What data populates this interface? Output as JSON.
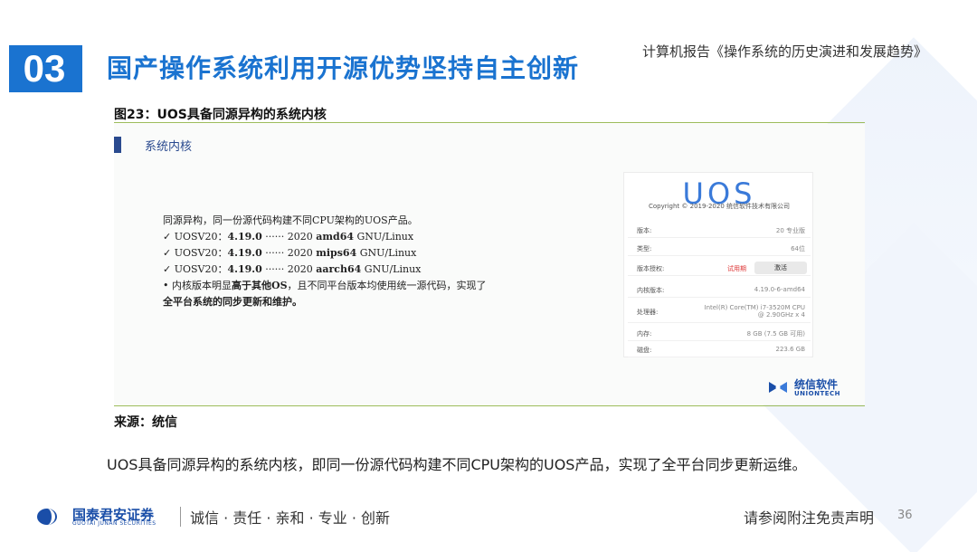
{
  "header": {
    "section_number": "03",
    "section_title": "国产操作系统利用开源优势坚持自主创新",
    "report_title": "计算机报告《操作系统的历史演进和发展趋势》"
  },
  "figure": {
    "title": "图23：UOS具备同源异构的系统内核",
    "source": "来源：统信",
    "screenshot": {
      "heading": "系统内核",
      "lead": "同源异构，同一份源代码构建不同CPU架构的UOS产品。",
      "items": [
        {
          "prefix": "✓ UOSV20：",
          "version": "4.19.0",
          "mid": " ······ 2020 ",
          "arch": "amd64",
          "suffix": " GNU/Linux"
        },
        {
          "prefix": "✓ UOSV20：",
          "version": "4.19.0",
          "mid": " ······ 2020 ",
          "arch": "mips64",
          "suffix": " GNU/Linux"
        },
        {
          "prefix": "✓ UOSV20：",
          "version": "4.19.0",
          "mid": " ······ 2020 ",
          "arch": "aarch64",
          "suffix": " GNU/Linux"
        }
      ],
      "note_a": "• 内核版本明显",
      "note_b": "高于其他OS",
      "note_c": "，且不同平台版本均使用统一源代码，实现了",
      "note_d": "全平台系统的同步更新和维护。",
      "sysinfo": {
        "logo": "UOS",
        "copyright": "Copyright © 2019-2020 统信软件技术有限公司",
        "rows": [
          {
            "key": "版本:",
            "value": "20 专业版"
          },
          {
            "key": "类型:",
            "value": "64位"
          },
          {
            "key": "版本授权:",
            "value": ""
          },
          {
            "key": "内核版本:",
            "value": "4.19.0-6-amd64"
          },
          {
            "key": "处理器:",
            "value": "Intel(R) Core(TM) i7-3520M CPU @ 2.90GHz x 4"
          },
          {
            "key": "内存:",
            "value": "8 GB (7.5 GB 可用)"
          },
          {
            "key": "磁盘:",
            "value": "223.6 GB"
          }
        ],
        "trial_label": "试用期",
        "activate_label": "激活"
      },
      "vendor": {
        "cn": "统信软件",
        "en": "UNIONTECH"
      }
    }
  },
  "summary": "UOS具备同源异构的系统内核，即同一份源代码构建不同CPU架构的UOS产品，实现了全平台同步更新运维。",
  "footer": {
    "company_cn": "国泰君安证券",
    "company_en": "GUOTAI JUNAN SECURITIES",
    "motto": "诚信 · 责任 · 亲和 · 专业 · 创新",
    "disclaimer": "请参阅附注免责声明",
    "page": "36"
  },
  "colors": {
    "brand_blue": "#1a73d0",
    "rule_green": "#9bbb59",
    "uos_blue": "#3a7ad9"
  }
}
